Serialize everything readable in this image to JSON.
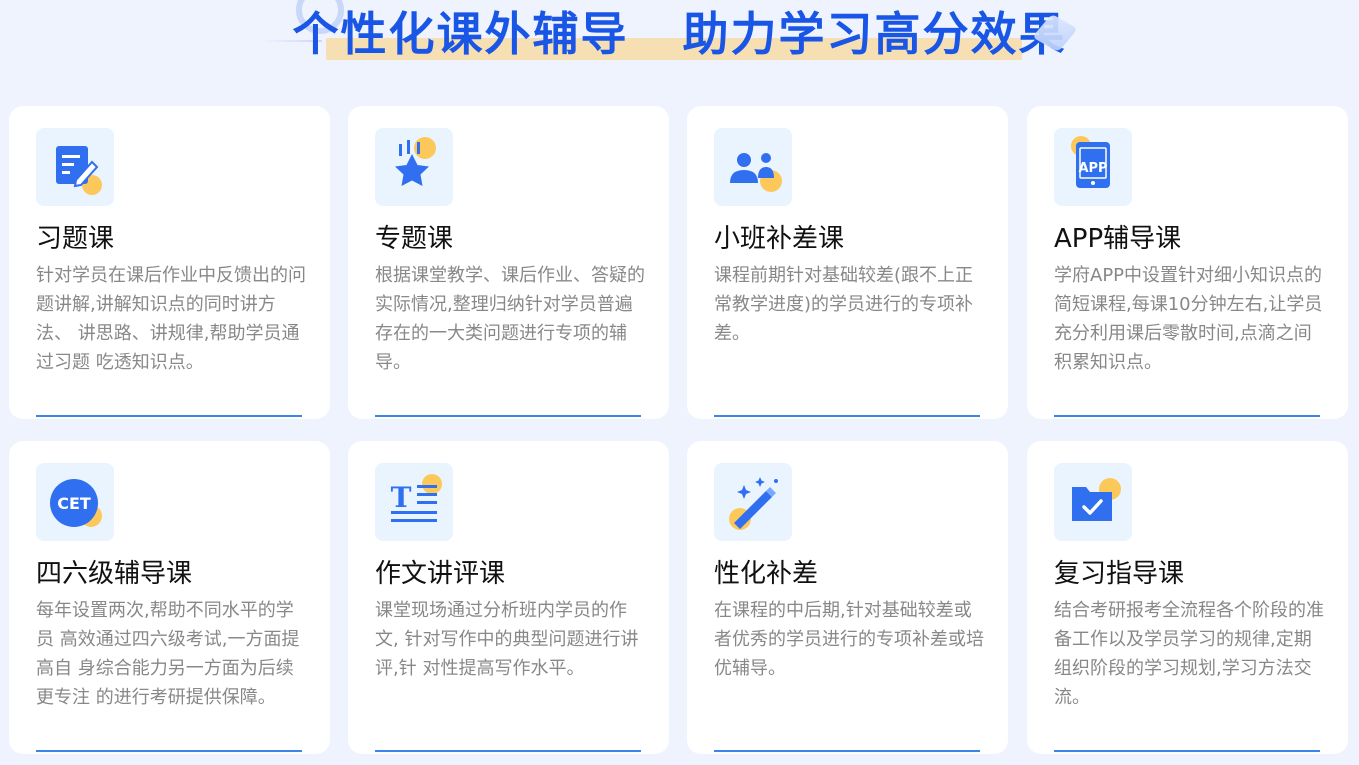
{
  "header": {
    "title": "个性化课外辅导   助力学习高分效果"
  },
  "colors": {
    "title": "#1a56e6",
    "accent_line": "#3b86e8",
    "icon_bg": "#e9f4fe",
    "icon_blue": "#2f6ff0",
    "icon_yellow": "#fcc85a",
    "page_bg": "#eef3fd"
  },
  "cards": [
    {
      "title": "习题课",
      "icon": "document-edit-icon",
      "desc": "针对学员在课后作业中反馈出的问 题讲解,讲解知识点的同时讲方法、 讲思路、讲规律,帮助学员通过习题 吃透知识点。"
    },
    {
      "title": "专题课",
      "icon": "star-icon",
      "desc": "根据课堂教学、课后作业、答疑的 实际情况,整理归纳针对学员普遍 存在的一大类问题进行专项的辅 导。"
    },
    {
      "title": "小班补差课",
      "icon": "users-icon",
      "desc": "课程前期针对基础较差(跟不上正常教学进度)的学员进行的专项补差。"
    },
    {
      "title": "APP辅导课",
      "icon": "app-icon",
      "icon_text": "APP",
      "desc": "学府APP中设置针对细小知识点的 简短课程,每课10分钟左右,让学员 充分利用课后零散时间,点滴之间 积累知识点。"
    },
    {
      "title": "四六级辅导课",
      "icon": "cet-icon",
      "icon_text": "CET",
      "desc": "每年设置两次,帮助不同水平的学员 高效通过四六级考试,一方面提高自 身综合能力另一方面为后续更专注 的进行考研提供保障。"
    },
    {
      "title": "作文讲评课",
      "icon": "text-format-icon",
      "icon_text": "T",
      "desc": "课堂现场通过分析班内学员的作文, 针对写作中的典型问题进行讲评,针 对性提高写作水平。"
    },
    {
      "title": "性化补差",
      "icon": "magic-wand-icon",
      "desc": "在课程的中后期,针对基础较差或者优秀的学员进行的专项补差或培优辅导。"
    },
    {
      "title": "复习指导课",
      "icon": "folder-check-icon",
      "desc": "结合考研报考全流程各个阶段的准 备工作以及学员学习的规律,定期 组织阶段的学习规划,学习方法交 流。"
    }
  ]
}
